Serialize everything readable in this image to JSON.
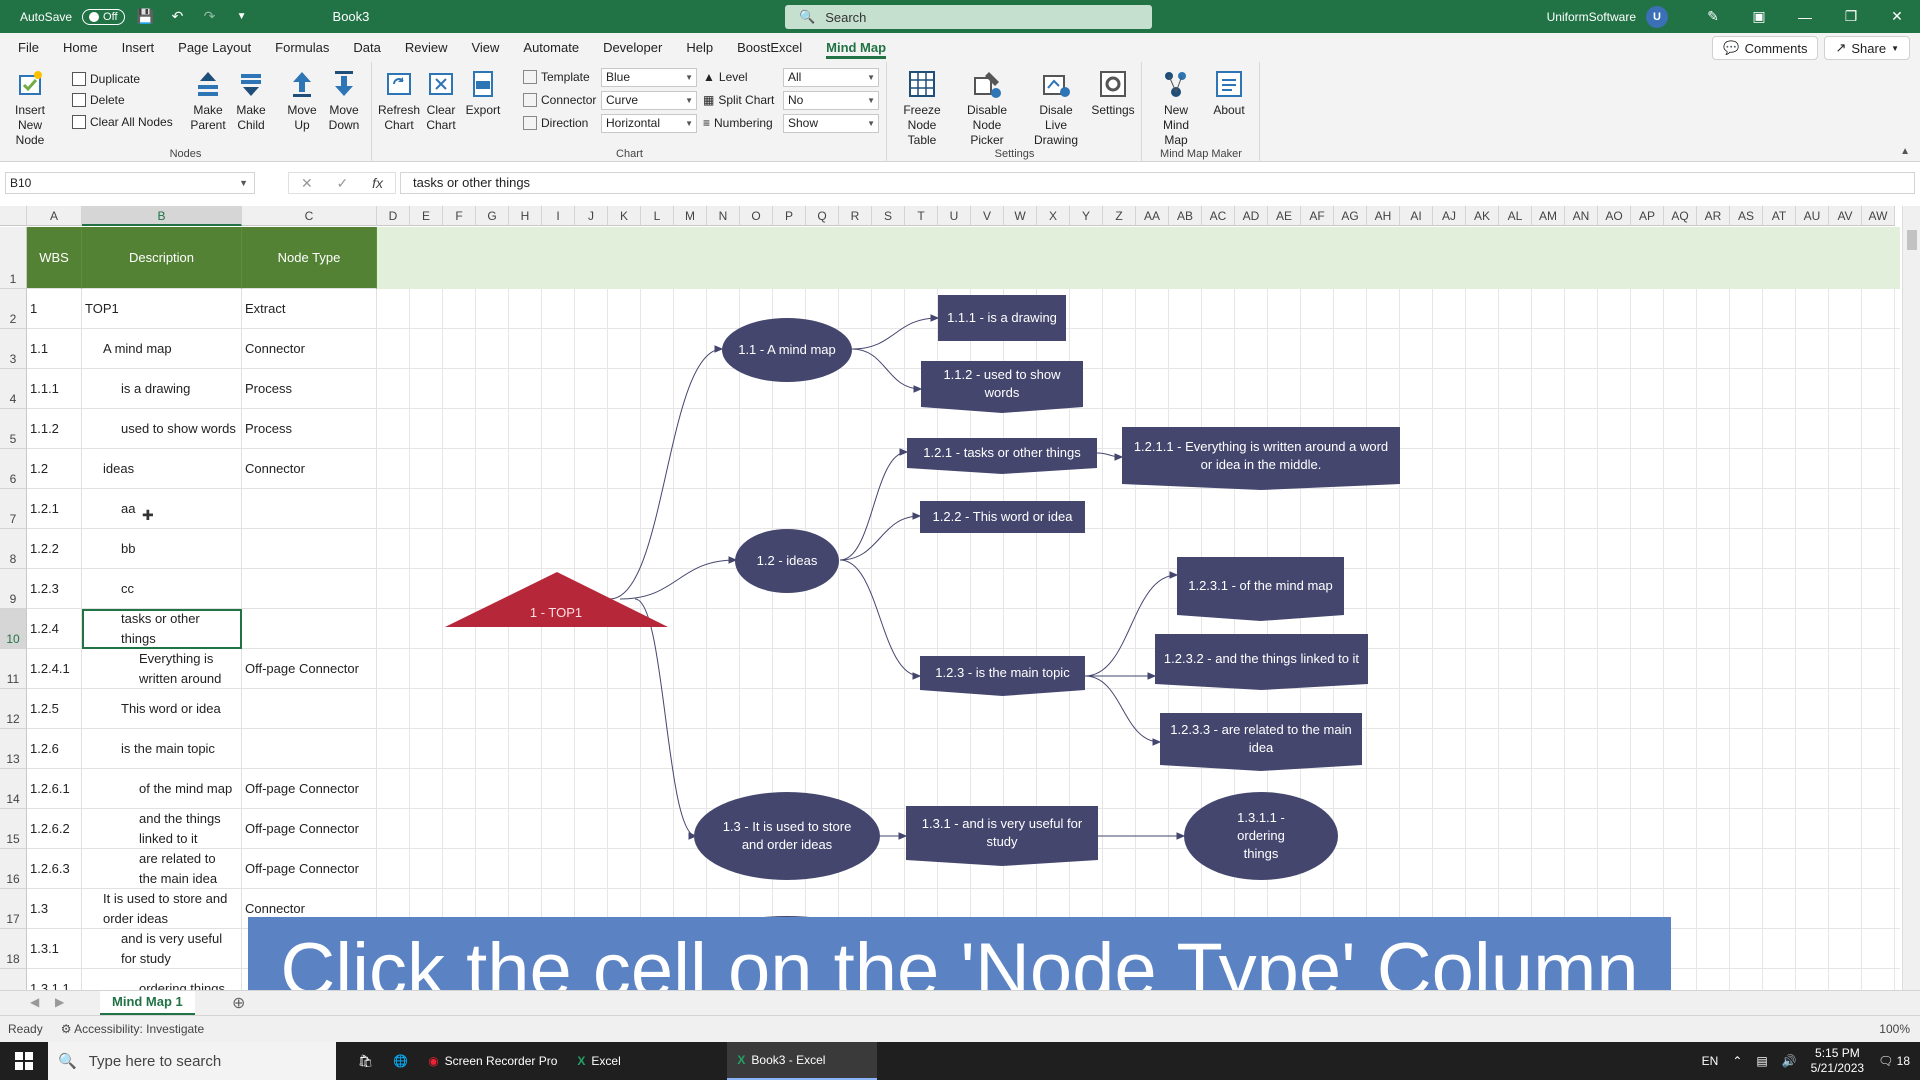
{
  "titlebar": {
    "autosave_label": "AutoSave",
    "autosave_state": "Off",
    "doc_title": "Book3",
    "search_placeholder": "Search",
    "user_name": "UniformSoftware",
    "user_initial": "U"
  },
  "menu": {
    "tabs": [
      "File",
      "Home",
      "Insert",
      "Page Layout",
      "Formulas",
      "Data",
      "Review",
      "View",
      "Automate",
      "Developer",
      "Help",
      "BoostExcel",
      "Mind Map"
    ],
    "active": "Mind Map",
    "comments": "Comments",
    "share": "Share"
  },
  "ribbon": {
    "nodes_group": "Nodes",
    "insert_new_node": "Insert New Node",
    "duplicate": "Duplicate",
    "delete": "Delete",
    "clear_all_nodes": "Clear All Nodes",
    "make_parent": "Make Parent",
    "make_child": "Make Child",
    "move_up": "Move Up",
    "move_down": "Move Down",
    "chart_group": "Chart",
    "refresh_chart": "Refresh Chart",
    "clear_chart": "Clear Chart",
    "export": "Export",
    "template_label": "Template",
    "template_value": "Blue",
    "connector_label": "Connector",
    "connector_value": "Curve",
    "direction_label": "Direction",
    "direction_value": "Horizontal",
    "level_label": "Level",
    "level_value": "All",
    "split_chart_label": "Split Chart",
    "split_chart_value": "No",
    "numbering_label": "Numbering",
    "numbering_value": "Show",
    "settings_group": "Settings",
    "freeze_node_table": "Freeze Node Table",
    "disable_node_picker": "Disable Node Picker",
    "disable_live_drawing": "Disale Live Drawing",
    "settings": "Settings",
    "mindmap_group": "Mind Map Maker",
    "new_mind_map": "New Mind Map",
    "about": "About"
  },
  "formula_bar": {
    "name_box": "B10",
    "formula": "tasks or other things"
  },
  "columns": [
    "A",
    "B",
    "C",
    "D",
    "E",
    "F",
    "G",
    "H",
    "I",
    "J",
    "K",
    "L",
    "M",
    "N",
    "O",
    "P",
    "Q",
    "R",
    "S",
    "T",
    "U",
    "V",
    "W",
    "X",
    "Y",
    "Z",
    "AA",
    "AB",
    "AC",
    "AD",
    "AE",
    "AF",
    "AG",
    "AH",
    "AI",
    "AJ",
    "AK",
    "AL",
    "AM",
    "AN",
    "AO",
    "AP",
    "AQ",
    "AR",
    "AS",
    "AT",
    "AU",
    "AV",
    "AW"
  ],
  "table": {
    "headers": [
      "WBS",
      "Description",
      "Node Type"
    ],
    "rows": [
      [
        "1",
        "TOP1",
        "Extract"
      ],
      [
        "1.1",
        "A mind map",
        "Connector"
      ],
      [
        "1.1.1",
        "is a drawing",
        "Process"
      ],
      [
        "1.1.2",
        "used to show words",
        "Process"
      ],
      [
        "1.2",
        "ideas",
        "Connector"
      ],
      [
        "1.2.1",
        "aa",
        ""
      ],
      [
        "1.2.2",
        "bb",
        ""
      ],
      [
        "1.2.3",
        "cc",
        ""
      ],
      [
        "1.2.4",
        "tasks or other things",
        ""
      ],
      [
        "1.2.4.1",
        "Everything is written around",
        "Off-page Connector"
      ],
      [
        "1.2.5",
        "This word or idea",
        ""
      ],
      [
        "1.2.6",
        "is the main topic",
        ""
      ],
      [
        "1.2.6.1",
        "of the mind map",
        "Off-page Connector"
      ],
      [
        "1.2.6.2",
        "and the things linked to it",
        "Off-page Connector"
      ],
      [
        "1.2.6.3",
        "are related to the main idea",
        "Off-page Connector"
      ],
      [
        "1.3",
        "It is used to store and order ideas",
        "Connector"
      ],
      [
        "1.3.1",
        "and is very useful for study",
        ""
      ],
      [
        "1.3.1.1",
        "ordering things",
        ""
      ]
    ]
  },
  "mindmap": {
    "root": "1 - TOP1",
    "n11": "1.1 - A mind map",
    "n111": "1.1.1 - is a drawing",
    "n112": "1.1.2 - used to show words",
    "n12": "1.2 - ideas",
    "n121": "1.2.1 - tasks or other things",
    "n1211": "1.2.1.1 - Everything is written around a word or idea in the middle.",
    "n122": "1.2.2 - This word or idea",
    "n123": "1.2.3 - is the main topic",
    "n1231": "1.2.3.1 - of the mind map",
    "n1232": "1.2.3.2 - and the things linked to it",
    "n1233": "1.2.3.3 - are related to the main idea",
    "n13": "1.3 - It is used to store and order ideas",
    "n131": "1.3.1 - and is very useful for study",
    "n1311": "1.3.1.1 - ordering things",
    "node_color": "#44466e",
    "root_color": "#b7273a"
  },
  "caption": "Click the cell on the 'Node Type' Column",
  "sheet_tab": "Mind Map 1",
  "status": {
    "ready": "Ready",
    "accessibility": "Accessibility: Investigate",
    "zoom": "100%"
  },
  "taskbar": {
    "search_placeholder": "Type here to search",
    "apps": [
      "Screen Recorder Pro",
      "Excel",
      "Book3 - Excel"
    ],
    "lang": "EN",
    "time": "5:15 PM",
    "date": "5/21/2023",
    "notif_count": "18"
  }
}
